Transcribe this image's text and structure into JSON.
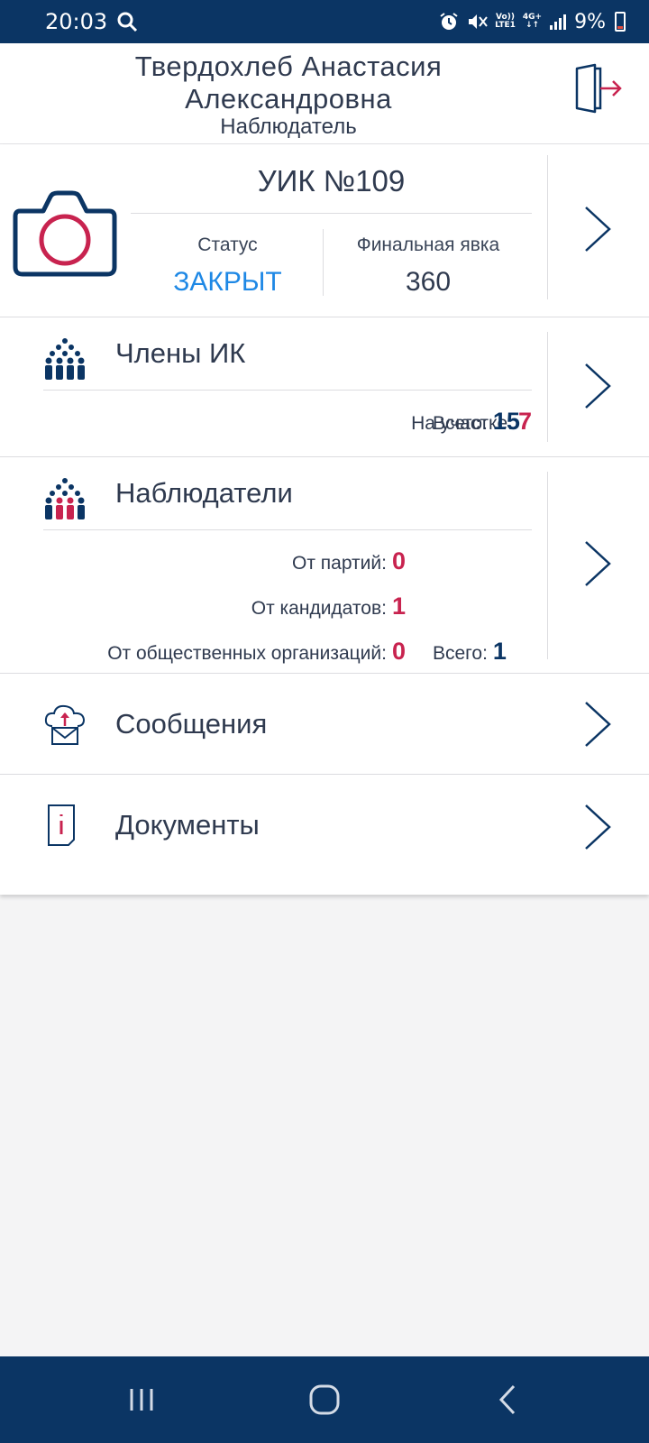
{
  "status_bar": {
    "time": "20:03",
    "volte": "Vo))",
    "lte": "LTE1",
    "net": "4G+",
    "battery": "9%"
  },
  "header": {
    "name": "Твердохлеб Анастасия Александровна",
    "role": "Наблюдатель"
  },
  "uik": {
    "title": "УИК №109",
    "status_label": "Статус",
    "status_value": "ЗАКРЫТ",
    "turnout_label": "Финальная явка",
    "turnout_value": "360"
  },
  "members": {
    "title": "Члены ИК",
    "on_site_label": "На участке:",
    "on_site_value": "7",
    "total_label": "Всего:",
    "total_value": "15"
  },
  "observers": {
    "title": "Наблюдатели",
    "parties_label": "От партий:",
    "parties_value": "0",
    "candidates_label": "От кандидатов:",
    "candidates_value": "1",
    "orgs_label": "От общественных организаций:",
    "orgs_value": "0",
    "total_label": "Всего:",
    "total_value": "1"
  },
  "messages": {
    "title": "Сообщения"
  },
  "documents": {
    "title": "Документы"
  },
  "colors": {
    "brand": "#0b3564",
    "accent_red": "#c8234f",
    "status_blue": "#1e88e5"
  },
  "icons": {
    "logout": "logout-door-icon",
    "camera": "camera-icon",
    "members": "people-group-icon",
    "observers": "observers-group-icon",
    "messages": "cloud-mail-icon",
    "documents": "document-info-icon"
  }
}
